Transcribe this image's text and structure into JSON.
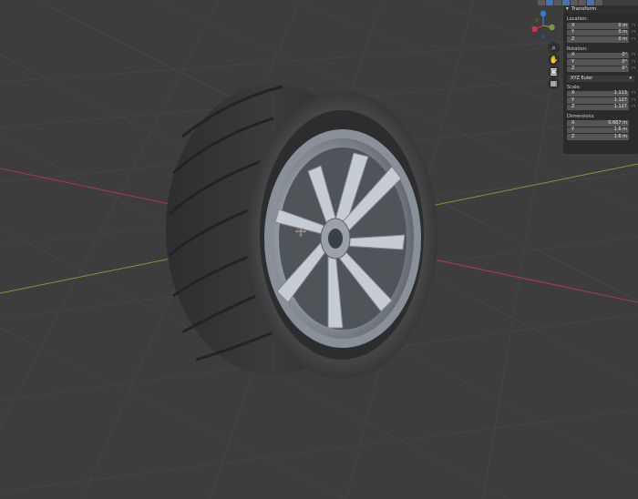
{
  "header_icons": [
    "view-icon",
    "mode-icon",
    "overlay-icon",
    "shading-icon",
    "wireframe-icon",
    "solid-icon",
    "material-icon",
    "rendered-icon"
  ],
  "colors": {
    "viewport_bg": "#3d3d3d",
    "panel_bg": "#2b2b2b",
    "field_bg": "#545454",
    "axis_x": "#b03a4a",
    "axis_y": "#7a9a3a",
    "gizmo_z": "#2f7bd8"
  },
  "gizmo": {
    "x_label": "X",
    "y_label": "Y",
    "z_label": "Z"
  },
  "npanel": {
    "section_title": "Transform",
    "location": {
      "label": "Location:",
      "x_label": "X",
      "x": "0 m",
      "y_label": "Y",
      "y": "0 m",
      "z_label": "Z",
      "z": "0 m"
    },
    "rotation": {
      "label": "Rotation:",
      "x_label": "X",
      "x": "0°",
      "y_label": "Y",
      "y": "0°",
      "z_label": "Z",
      "z": "0°",
      "mode": "XYZ Euler"
    },
    "scale": {
      "label": "Scale:",
      "x_label": "X",
      "x": "1.113",
      "y_label": "Y",
      "y": "1.127",
      "z_label": "Z",
      "z": "1.127"
    },
    "dimensions": {
      "label": "Dimensions:",
      "x_label": "X",
      "x": "0.667 m",
      "y_label": "Y",
      "y": "1.6 m",
      "z_label": "Z",
      "z": "1.6 m"
    }
  }
}
